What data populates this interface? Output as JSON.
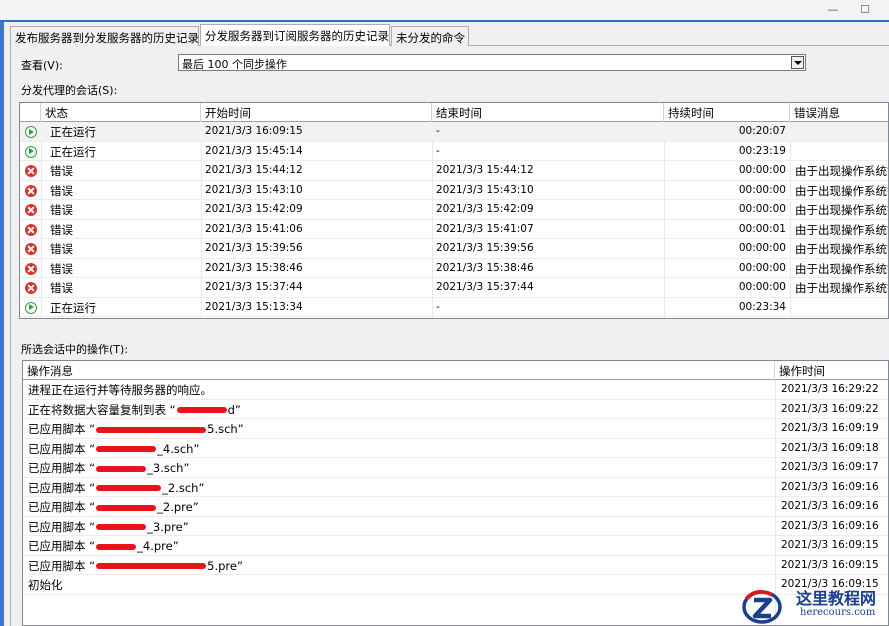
{
  "window": {
    "minimize_glyph": "—",
    "maximize_glyph": "☐"
  },
  "tabs": [
    {
      "label": "发布服务器到分发服务器的历史记录",
      "active": false
    },
    {
      "label": "分发服务器到订阅服务器的历史记录",
      "active": true
    },
    {
      "label": "未分发的命令",
      "active": false
    }
  ],
  "view": {
    "label": "查看(V):",
    "selected": "最后 100 个同步操作"
  },
  "sessions": {
    "label": "分发代理的会话(S):",
    "columns": [
      "状态",
      "开始时间",
      "结束时间",
      "持续时间",
      "错误消息"
    ],
    "rows": [
      {
        "icon": "running-icon",
        "status": "正在运行",
        "start": "2021/3/3 16:09:15",
        "end": "-",
        "duration": "00:20:07",
        "error": ""
      },
      {
        "icon": "running-icon",
        "status": "正在运行",
        "start": "2021/3/3 15:45:14",
        "end": "-",
        "duration": "00:23:19",
        "error": ""
      },
      {
        "icon": "error-icon",
        "status": "错误",
        "start": "2021/3/3 15:44:12",
        "end": "2021/3/3 15:44:12",
        "duration": "00:00:00",
        "error": "由于出现操作系统错"
      },
      {
        "icon": "error-icon",
        "status": "错误",
        "start": "2021/3/3 15:43:10",
        "end": "2021/3/3 15:43:10",
        "duration": "00:00:00",
        "error": "由于出现操作系统错"
      },
      {
        "icon": "error-icon",
        "status": "错误",
        "start": "2021/3/3 15:42:09",
        "end": "2021/3/3 15:42:09",
        "duration": "00:00:00",
        "error": "由于出现操作系统错"
      },
      {
        "icon": "error-icon",
        "status": "错误",
        "start": "2021/3/3 15:41:06",
        "end": "2021/3/3 15:41:07",
        "duration": "00:00:01",
        "error": "由于出现操作系统错"
      },
      {
        "icon": "error-icon",
        "status": "错误",
        "start": "2021/3/3 15:39:56",
        "end": "2021/3/3 15:39:56",
        "duration": "00:00:00",
        "error": "由于出现操作系统错"
      },
      {
        "icon": "error-icon",
        "status": "错误",
        "start": "2021/3/3 15:38:46",
        "end": "2021/3/3 15:38:46",
        "duration": "00:00:00",
        "error": "由于出现操作系统错"
      },
      {
        "icon": "error-icon",
        "status": "错误",
        "start": "2021/3/3 15:37:44",
        "end": "2021/3/3 15:37:44",
        "duration": "00:00:00",
        "error": "由于出现操作系统错"
      },
      {
        "icon": "running-icon",
        "status": "正在运行",
        "start": "2021/3/3 15:13:34",
        "end": "-",
        "duration": "00:23:34",
        "error": ""
      }
    ]
  },
  "actions": {
    "label": "所选会话中的操作(T):",
    "columns": [
      "操作消息",
      "操作时间"
    ],
    "rows": [
      {
        "pre": "进程正在运行并等待服务器的响应。",
        "post": "",
        "time": "2021/3/3 16:29:22"
      },
      {
        "pre": "正在将数据大容量复制到表 “",
        "post": "d”",
        "time": "2021/3/3 16:09:22"
      },
      {
        "pre": "已应用脚本 “",
        "post": "5.sch”",
        "time": "2021/3/3 16:09:19"
      },
      {
        "pre": "已应用脚本 “",
        "post": "_4.sch”",
        "time": "2021/3/3 16:09:18"
      },
      {
        "pre": "已应用脚本 “",
        "post": "_3.sch”",
        "time": "2021/3/3 16:09:17"
      },
      {
        "pre": "已应用脚本 “",
        "post": "_2.sch”",
        "time": "2021/3/3 16:09:16"
      },
      {
        "pre": "已应用脚本 “",
        "post": "_2.pre”",
        "time": "2021/3/3 16:09:16"
      },
      {
        "pre": "已应用脚本 “",
        "post": "_3.pre”",
        "time": "2021/3/3 16:09:16"
      },
      {
        "pre": "已应用脚本 “",
        "post": "_4.pre”",
        "time": "2021/3/3 16:09:15"
      },
      {
        "pre": "已应用脚本 “",
        "post": "5.pre”",
        "time": "2021/3/3 16:09:15"
      },
      {
        "pre": "初始化",
        "post": "",
        "time": "2021/3/3 16:09:15"
      }
    ]
  },
  "watermark": {
    "title": "这里教程网",
    "url": "herecours.com"
  }
}
